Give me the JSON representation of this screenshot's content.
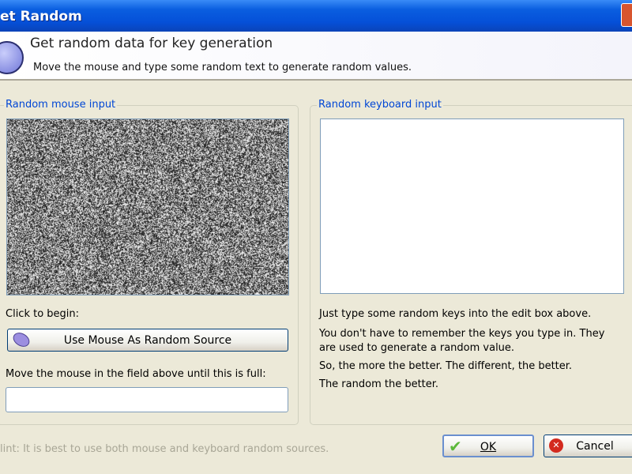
{
  "window": {
    "title": "et Random"
  },
  "header": {
    "title": "Get random data for key generation",
    "subtitle": "Move the mouse and type some random text to generate random values.",
    "icon": "key-icon"
  },
  "mouse": {
    "group_label": "Random mouse input",
    "click_label": "Click to begin:",
    "button_label": "Use Mouse As Random Source",
    "button_icon": "mouse-icon",
    "progress_label": "Move the mouse in the field above until this is full:",
    "progress": 0
  },
  "keyboard": {
    "group_label": "Random keyboard input",
    "value": "",
    "lines": [
      "Just type some random keys into the edit box above.",
      "You don't have to remember the keys you type in. They",
      "are used to generate a random value.",
      "So, the more the better. The different, the better.",
      "The random the better."
    ]
  },
  "hint": "Hint: It is best to use both mouse and keyboard random sources.",
  "hint_visible": "lint: It is best to use both mouse and keyboard random sources.",
  "buttons": {
    "ok": "OK",
    "cancel": "Cancel"
  }
}
